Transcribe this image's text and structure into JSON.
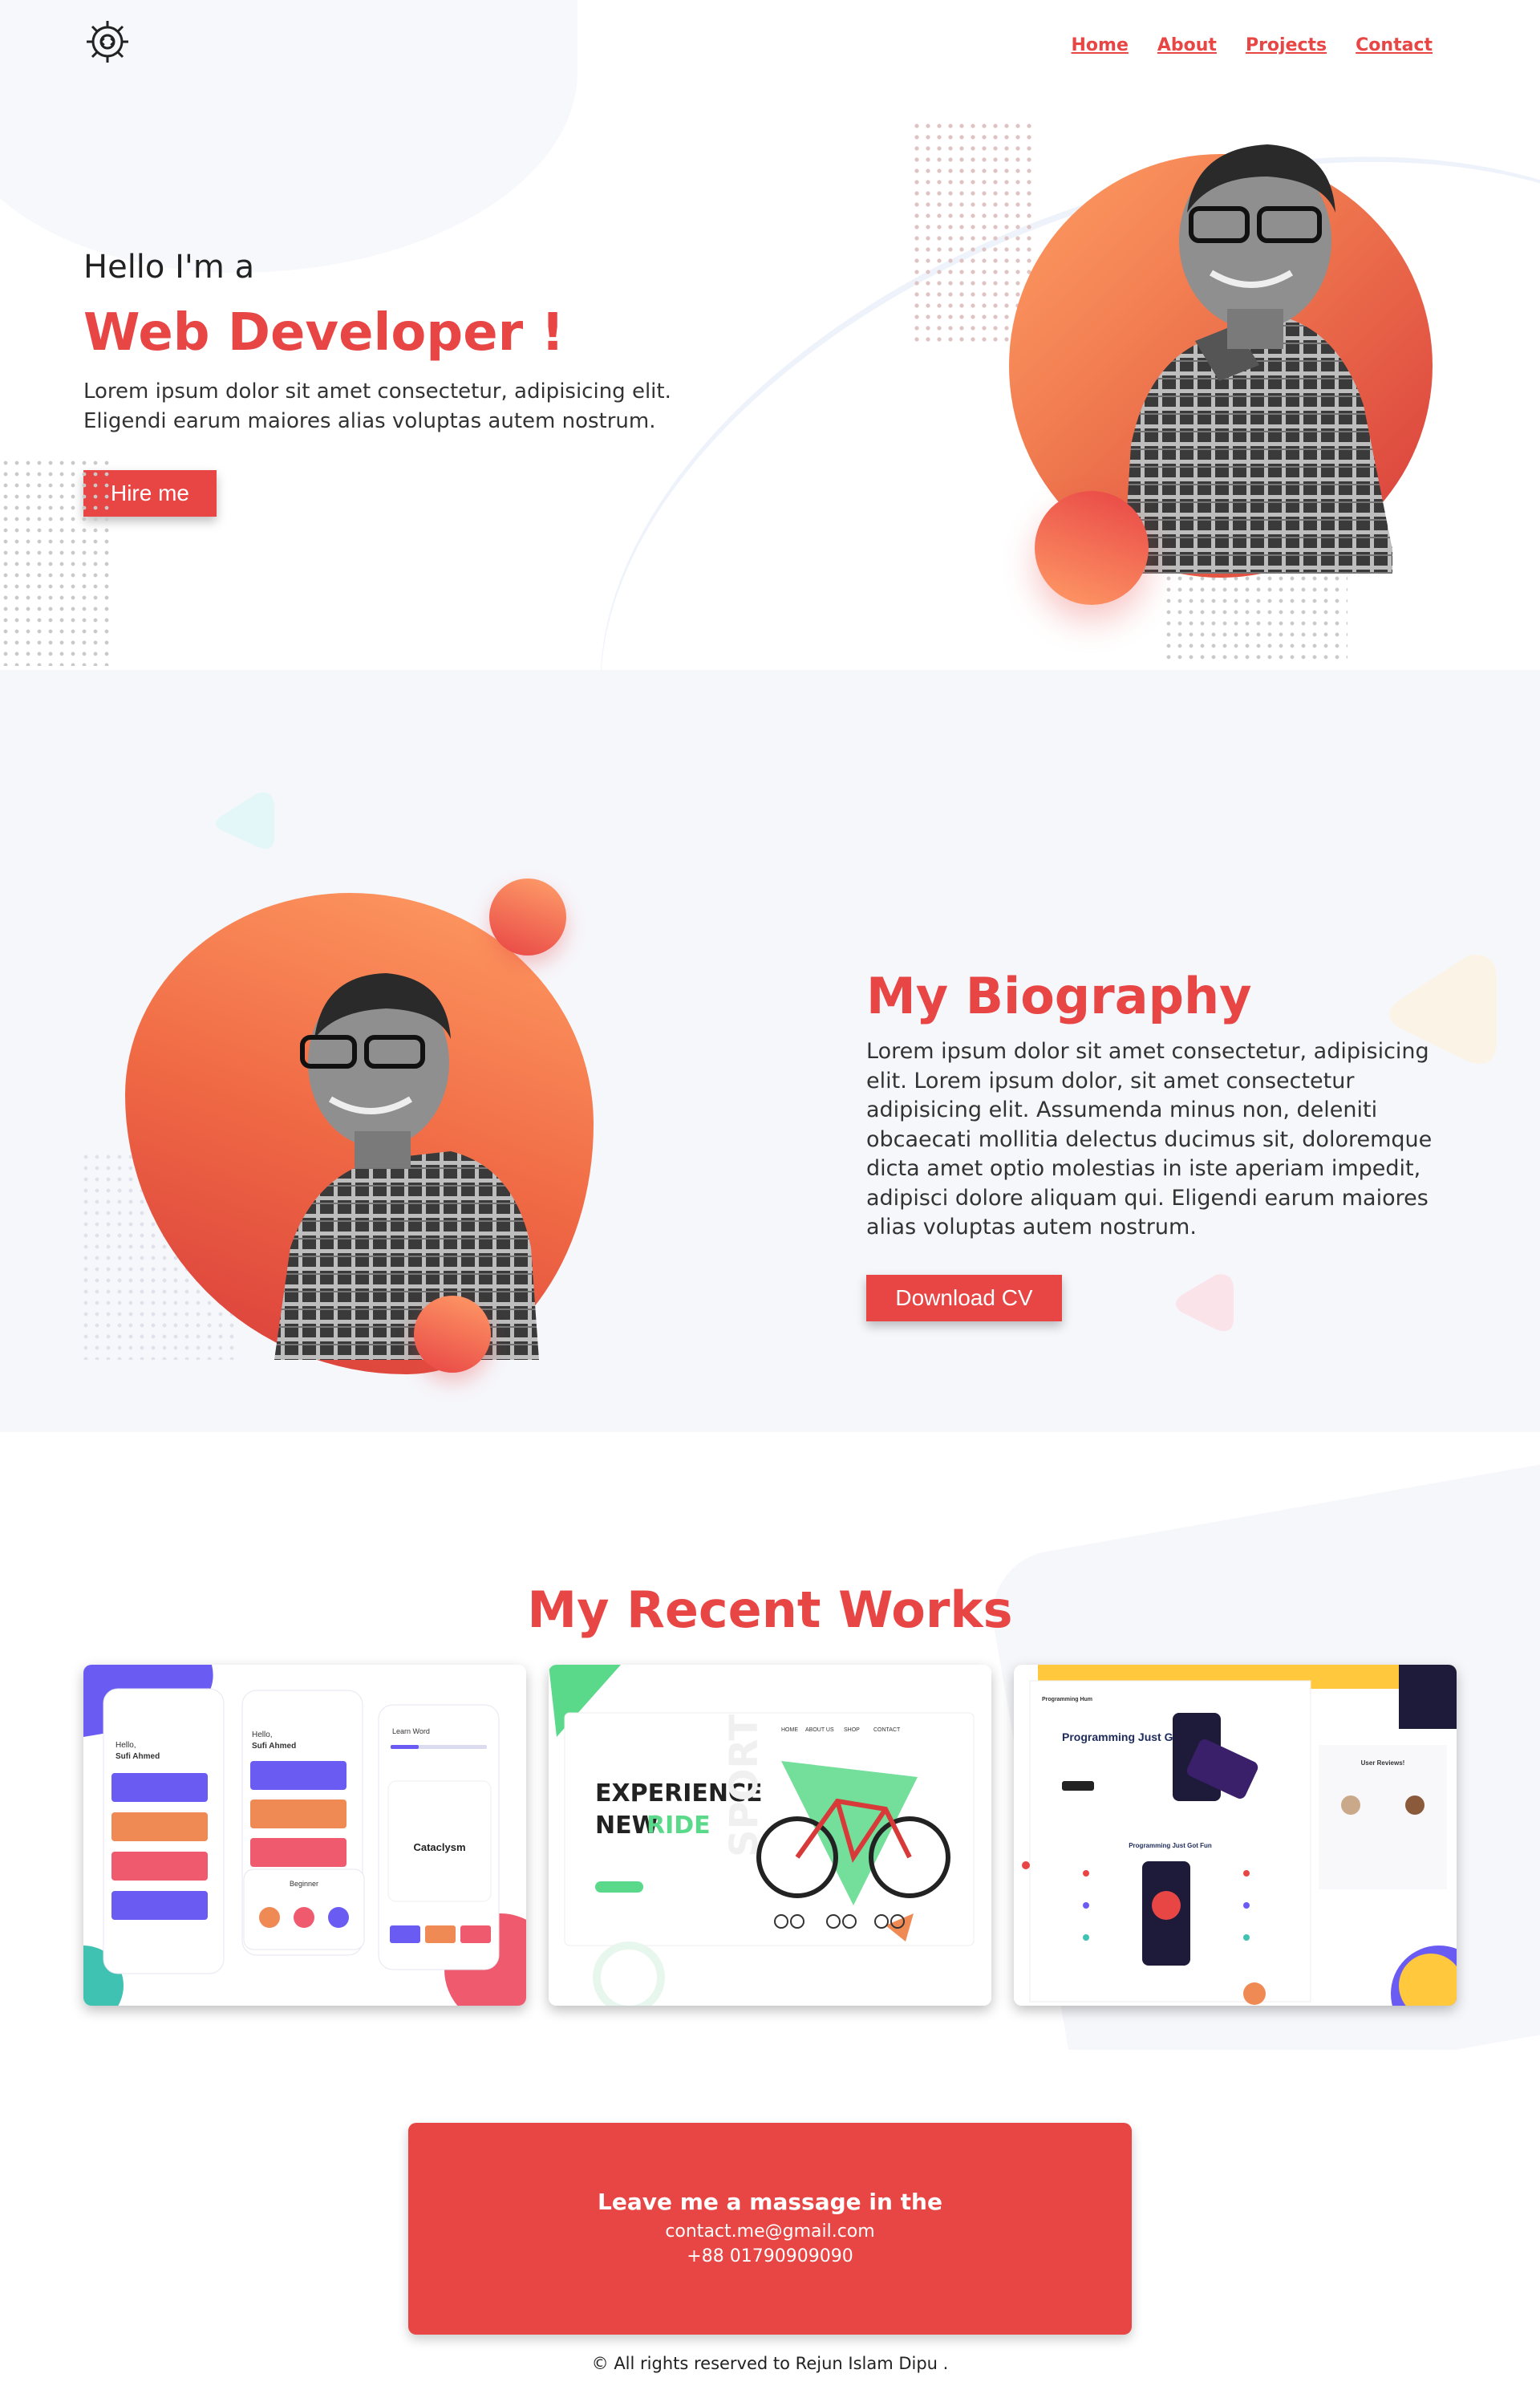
{
  "colors": {
    "accent": "#e84545",
    "hero_bg": "#ffffff",
    "bio_bg": "#f6f7fb"
  },
  "logo": {
    "icon": "gear-code-icon"
  },
  "nav": {
    "items": [
      {
        "label": "Home"
      },
      {
        "label": "About"
      },
      {
        "label": "Projects"
      },
      {
        "label": "Contact"
      }
    ]
  },
  "hero": {
    "greeting": "Hello I'm a",
    "role": "Web Developer !",
    "description": "Lorem ipsum dolor sit amet consectetur, adipisicing elit. Eligendi earum maiores alias voluptas autem nostrum.",
    "button_label": "Hire me"
  },
  "biography": {
    "title": "My Biography",
    "text": "Lorem ipsum dolor sit amet consectetur, adipisicing elit. Lorem ipsum dolor, sit amet consectetur adipisicing elit. Assumenda minus non, deleniti obcaecati mollitia delectus ducimus sit, doloremque dicta amet optio molestias in iste aperiam impedit, adipisci dolore aliquam qui. Eligendi earum maiores alias voluptas autem nostrum.",
    "button_label": "Download CV"
  },
  "works": {
    "title": "My Recent Works",
    "projects": [
      {
        "greeting": "Hello,",
        "name": "Sufi Ahmed",
        "level_title": "Beginner",
        "word_header": "Learn Word",
        "word": "Cataclysm"
      },
      {
        "headline_1": "EXPERIENCE",
        "headline_2": "NEW",
        "headline_accent": "RIDE",
        "side_word": "SPORT",
        "nav": [
          "HOME",
          "ABOUT US",
          "SHOP",
          "CONTACT"
        ]
      },
      {
        "brand": "Programming Hum",
        "headline": "Programming Just Got Fun",
        "section": "Programming Just Got Fun",
        "reviews": "User Reviews!"
      }
    ]
  },
  "contact": {
    "title": "Leave me a massage in the",
    "email": "contact.me@gmail.com",
    "phone": "+88 01790909090"
  },
  "footer": {
    "text": "© All rights reserved to Rejun Islam Dipu ."
  }
}
